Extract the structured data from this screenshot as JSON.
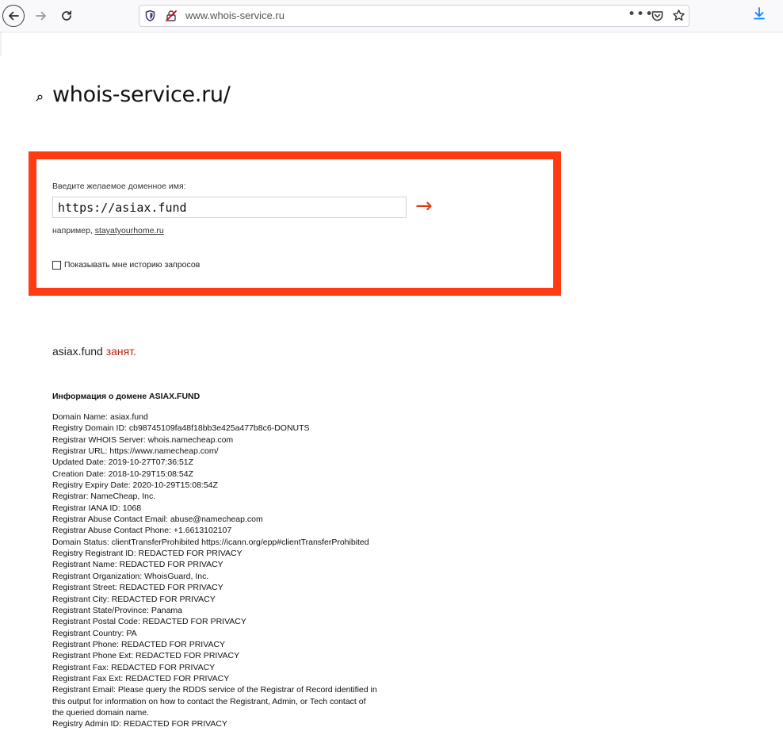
{
  "browser": {
    "url": "www.whois-service.ru"
  },
  "page": {
    "site_title": "whois-service.ru/",
    "form": {
      "prompt": "Введите желаемое доменное имя:",
      "input_value": "https://asiax.fund",
      "submit_arrow": "→",
      "example_prefix": "например,",
      "example_link": "stayatyourhome.ru",
      "history_label": "Показывать мне историю запросов",
      "history_checked": false
    },
    "result": {
      "domain": "asiax.fund",
      "status": "занят.",
      "info_title": "Информация о домене ASIAX.FUND",
      "whois_lines": [
        "Domain Name: asiax.fund",
        "Registry Domain ID: cb98745109fa48f18bb3e425a477b8c6-DONUTS",
        "Registrar WHOIS Server: whois.namecheap.com",
        "Registrar URL: https://www.namecheap.com/",
        "Updated Date: 2019-10-27T07:36:51Z",
        "Creation Date: 2018-10-29T15:08:54Z",
        "Registry Expiry Date: 2020-10-29T15:08:54Z",
        "Registrar: NameCheap, Inc.",
        "Registrar IANA ID: 1068",
        "Registrar Abuse Contact Email: abuse@namecheap.com",
        "Registrar Abuse Contact Phone: +1.6613102107",
        "Domain Status: clientTransferProhibited https://icann.org/epp#clientTransferProhibited",
        "Registry Registrant ID: REDACTED FOR PRIVACY",
        "Registrant Name: REDACTED FOR PRIVACY",
        "Registrant Organization: WhoisGuard, Inc.",
        "Registrant Street: REDACTED FOR PRIVACY",
        "Registrant City: REDACTED FOR PRIVACY",
        "Registrant State/Province: Panama",
        "Registrant Postal Code: REDACTED FOR PRIVACY",
        "Registrant Country: PA",
        "Registrant Phone: REDACTED FOR PRIVACY",
        "Registrant Phone Ext: REDACTED FOR PRIVACY",
        "Registrant Fax: REDACTED FOR PRIVACY",
        "Registrant Fax Ext: REDACTED FOR PRIVACY",
        "Registrant Email: Please query the RDDS service of the Registrar of Record identified in",
        "this output for information on how to contact the Registrant, Admin, or Tech contact of",
        "the queried domain name.",
        "Registry Admin ID: REDACTED FOR PRIVACY"
      ]
    }
  },
  "icons": {
    "back": "arrow-left-icon",
    "forward": "arrow-right-icon",
    "reload": "reload-icon",
    "shield": "tracking-shield-icon",
    "insecure": "insecure-lock-icon",
    "menu": "more-dots-icon",
    "pocket": "pocket-icon",
    "bookmark": "star-icon",
    "download": "download-icon",
    "search": "magnifier-icon"
  },
  "colors": {
    "accent_border": "#fe3b12",
    "status_taken": "#b5261a",
    "download_blue": "#0a84ff"
  }
}
